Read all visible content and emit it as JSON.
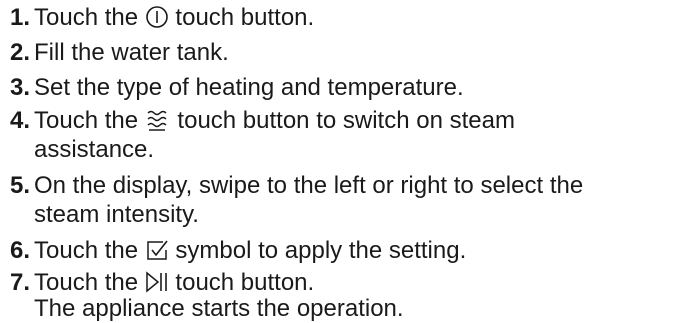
{
  "steps": [
    {
      "num": "1.",
      "before": "Touch the",
      "icon": "power-icon",
      "after": "touch button."
    },
    {
      "num": "2.",
      "text": "Fill the water tank."
    },
    {
      "num": "3.",
      "text": "Set the type of heating and temperature."
    },
    {
      "num": "4.",
      "before": "Touch the",
      "icon": "steam-icon",
      "after": "touch button to switch on steam",
      "line2": "assistance."
    },
    {
      "num": "5.",
      "line1": "On the display, swipe to the left or right to select the",
      "line2": "steam intensity."
    },
    {
      "num": "6.",
      "before": "Touch the",
      "icon": "checkbox-check-icon",
      "after": "symbol to apply the setting."
    },
    {
      "num": "7.",
      "before": "Touch the",
      "icon": "play-pause-icon",
      "after": "touch button."
    }
  ],
  "result": "The appliance starts the operation.",
  "colors": {
    "text": "#1a1a1a",
    "background": "#ffffff"
  }
}
